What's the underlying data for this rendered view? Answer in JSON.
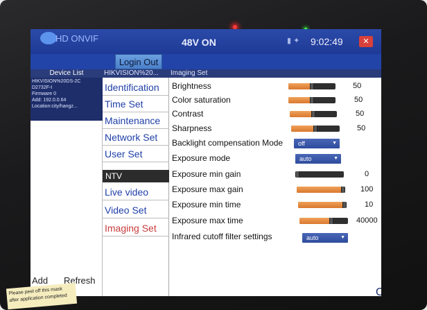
{
  "status_bar": {
    "app_title": "HD ONVIF",
    "voltage": "48V ON",
    "time": "9:02:49",
    "close_glyph": "✕"
  },
  "toolbar": {
    "login_label": "Login Out"
  },
  "device_list": {
    "header": "Device List",
    "info": [
      "HIKVISION%20DS-2C",
      "D2732F-I",
      "Firmware 0",
      "Add: 192.0.0.64",
      "Location:city/hangz..."
    ],
    "add_label": "Add",
    "refresh_label": "Refresh"
  },
  "menu": {
    "header": "HIKVISION%20...",
    "items": [
      "Identification",
      "Time Set",
      "Maintenance",
      "Network Set",
      "User Set"
    ],
    "ntv_header": "NTV",
    "ntv_items": [
      "Live video",
      "Video Set",
      "Imaging Set"
    ],
    "active_item": "Imaging Set"
  },
  "imaging": {
    "header": "Imaging Set",
    "brightness": {
      "label": "Brightness",
      "value": "50",
      "fill": 0.5
    },
    "saturation": {
      "label": "Color saturation",
      "value": "50",
      "fill": 0.5
    },
    "contrast": {
      "label": "Contrast",
      "value": "50",
      "fill": 0.5
    },
    "sharpness": {
      "label": "Sharpness",
      "value": "50",
      "fill": 0.5
    },
    "backlight": {
      "label": "Backlight compensation Mode",
      "value": "off"
    },
    "exposure_mode": {
      "label": "Exposure mode",
      "value": "auto"
    },
    "exposure_min_gain": {
      "label": "Exposure min gain",
      "value": "0",
      "fill": 0.0
    },
    "exposure_max_gain": {
      "label": "Exposure max gain",
      "value": "100",
      "fill": 1.0
    },
    "exposure_min_time": {
      "label": "Exposure min time",
      "value": "10",
      "fill": 1.0
    },
    "exposure_max_time": {
      "label": "Exposure max time",
      "value": "40000",
      "fill": 0.65
    },
    "ir_cutoff": {
      "label": "Infrared cutoff filter settings",
      "value": "auto"
    },
    "ok_label": "OK"
  },
  "sticker": {
    "line1": "Please peel off this mask",
    "line2": "after application completed"
  },
  "colors": {
    "accent_blue": "#1f3fa8",
    "active_red": "#c83b3b",
    "slider_orange": "#e08a3c"
  },
  "icons": [
    "app-logo-icon",
    "close-icon",
    "dropdown-caret-icon"
  ]
}
